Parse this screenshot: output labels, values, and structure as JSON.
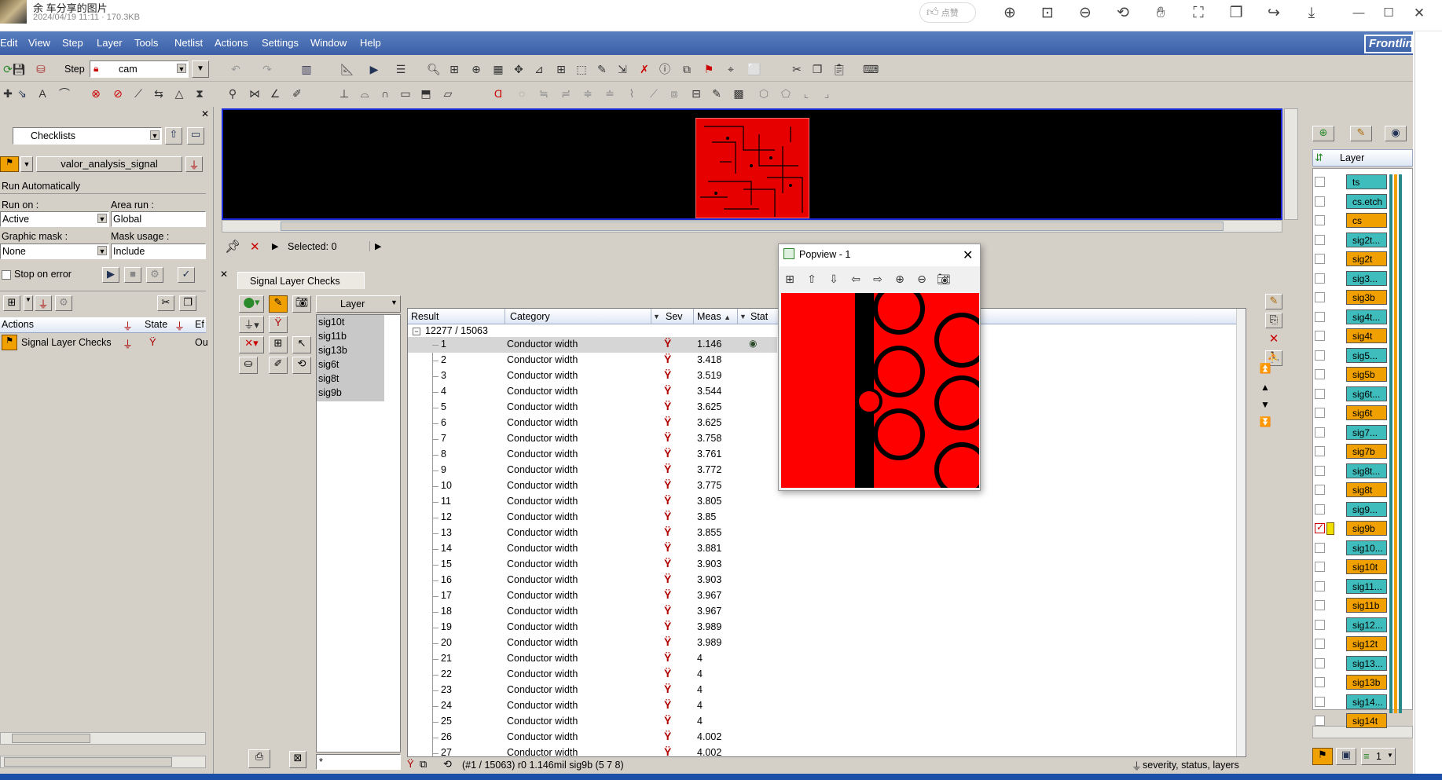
{
  "viewer": {
    "title": "余 车分享的图片",
    "subtitle": "2024/04/19 11:11 · 170.3KB",
    "like_label": "点赞",
    "icons": [
      "zoom-in-icon",
      "fit-icon",
      "zoom-out-icon",
      "rotate-icon",
      "hand-icon",
      "crop-icon",
      "copy-icon",
      "share-icon",
      "download-icon",
      "minimize-icon",
      "maximize-icon",
      "close-icon"
    ]
  },
  "menu": [
    "Edit",
    "View",
    "Step",
    "Layer",
    "Tools",
    "Netlist",
    "Actions",
    "Settings",
    "Window",
    "Help"
  ],
  "logo": "Frontline",
  "toolbar": {
    "step_label": "Step",
    "step_value": "cam"
  },
  "left_panel": {
    "checklists_value": "Checklists",
    "analysis_value": "valor_analysis_signal",
    "run_automatically": "Run Automatically",
    "run_on_label": "Run on :",
    "run_on_value": "Active",
    "area_run_label": "Area run :",
    "area_run_value": "Global",
    "graphic_mask_label": "Graphic mask :",
    "graphic_mask_value": "None",
    "mask_usage_label": "Mask usage :",
    "mask_usage_value": "Include",
    "stop_on_error": "Stop on error",
    "actions_header": {
      "actions": "Actions",
      "state": "State",
      "ef": "Ef"
    },
    "action_row": {
      "name": "Signal Layer Checks",
      "ef": "Ou"
    }
  },
  "selection": {
    "label": "Selected: 0"
  },
  "checks_tab": "Signal Layer Checks",
  "layer_filter": {
    "header": "Layer",
    "items": [
      "sig10t",
      "sig11b",
      "sig13b",
      "sig6t",
      "sig8t",
      "sig9b"
    ],
    "search_value": "*"
  },
  "results": {
    "headers": {
      "result": "Result",
      "category": "Category",
      "sev": "Sev",
      "meas": "Meas",
      "stat": "Stat"
    },
    "group_label": "12277 / 15063",
    "rows": [
      {
        "id": "1",
        "category": "Conductor width",
        "meas": "1.146"
      },
      {
        "id": "2",
        "category": "Conductor width",
        "meas": "3.418"
      },
      {
        "id": "3",
        "category": "Conductor width",
        "meas": "3.519"
      },
      {
        "id": "4",
        "category": "Conductor width",
        "meas": "3.544"
      },
      {
        "id": "5",
        "category": "Conductor width",
        "meas": "3.625"
      },
      {
        "id": "6",
        "category": "Conductor width",
        "meas": "3.625"
      },
      {
        "id": "7",
        "category": "Conductor width",
        "meas": "3.758"
      },
      {
        "id": "8",
        "category": "Conductor width",
        "meas": "3.761"
      },
      {
        "id": "9",
        "category": "Conductor width",
        "meas": "3.772"
      },
      {
        "id": "10",
        "category": "Conductor width",
        "meas": "3.775"
      },
      {
        "id": "11",
        "category": "Conductor width",
        "meas": "3.805"
      },
      {
        "id": "12",
        "category": "Conductor width",
        "meas": "3.85"
      },
      {
        "id": "13",
        "category": "Conductor width",
        "meas": "3.855"
      },
      {
        "id": "14",
        "category": "Conductor width",
        "meas": "3.881"
      },
      {
        "id": "15",
        "category": "Conductor width",
        "meas": "3.903"
      },
      {
        "id": "16",
        "category": "Conductor width",
        "meas": "3.903"
      },
      {
        "id": "17",
        "category": "Conductor width",
        "meas": "3.967"
      },
      {
        "id": "18",
        "category": "Conductor width",
        "meas": "3.967"
      },
      {
        "id": "19",
        "category": "Conductor width",
        "meas": "3.989"
      },
      {
        "id": "20",
        "category": "Conductor width",
        "meas": "3.989"
      },
      {
        "id": "21",
        "category": "Conductor width",
        "meas": "4"
      },
      {
        "id": "22",
        "category": "Conductor width",
        "meas": "4"
      },
      {
        "id": "23",
        "category": "Conductor width",
        "meas": "4"
      },
      {
        "id": "24",
        "category": "Conductor width",
        "meas": "4"
      },
      {
        "id": "25",
        "category": "Conductor width",
        "meas": "4"
      },
      {
        "id": "26",
        "category": "Conductor width",
        "meas": "4.002"
      },
      {
        "id": "27",
        "category": "Conductor width",
        "meas": "4.002"
      }
    ],
    "status_text": "(#1 / 15063)  r0  1.146mil  sig9b  (5 7 8)",
    "filter_text": "severity, status, layers"
  },
  "popview": {
    "title": "Popview - 1"
  },
  "layers_panel": {
    "header": "Layer",
    "items": [
      {
        "name": "ts",
        "color": "teal"
      },
      {
        "name": "cs.etch",
        "color": "teal"
      },
      {
        "name": "cs",
        "color": "orange"
      },
      {
        "name": "sig2t...",
        "color": "teal"
      },
      {
        "name": "sig2t",
        "color": "orange"
      },
      {
        "name": "sig3...",
        "color": "teal"
      },
      {
        "name": "sig3b",
        "color": "orange"
      },
      {
        "name": "sig4t...",
        "color": "teal"
      },
      {
        "name": "sig4t",
        "color": "orange"
      },
      {
        "name": "sig5...",
        "color": "teal"
      },
      {
        "name": "sig5b",
        "color": "orange"
      },
      {
        "name": "sig6t...",
        "color": "teal"
      },
      {
        "name": "sig6t",
        "color": "orange"
      },
      {
        "name": "sig7...",
        "color": "teal"
      },
      {
        "name": "sig7b",
        "color": "orange"
      },
      {
        "name": "sig8t...",
        "color": "teal"
      },
      {
        "name": "sig8t",
        "color": "orange"
      },
      {
        "name": "sig9...",
        "color": "teal"
      },
      {
        "name": "sig9b",
        "color": "orange"
      },
      {
        "name": "sig10...",
        "color": "teal"
      },
      {
        "name": "sig10t",
        "color": "orange"
      },
      {
        "name": "sig11...",
        "color": "teal"
      },
      {
        "name": "sig11b",
        "color": "orange"
      },
      {
        "name": "sig12...",
        "color": "teal"
      },
      {
        "name": "sig12t",
        "color": "orange"
      },
      {
        "name": "sig13...",
        "color": "teal"
      },
      {
        "name": "sig13b",
        "color": "orange"
      },
      {
        "name": "sig14...",
        "color": "teal"
      },
      {
        "name": "sig14t",
        "color": "orange"
      }
    ],
    "footer_value": "1"
  },
  "colors": {
    "menubar": "#3c5fa6",
    "board": "#e60000",
    "layer_teal": "#3fbcbc",
    "layer_orange": "#f0a000",
    "selection_border": "#1a2ad8"
  }
}
